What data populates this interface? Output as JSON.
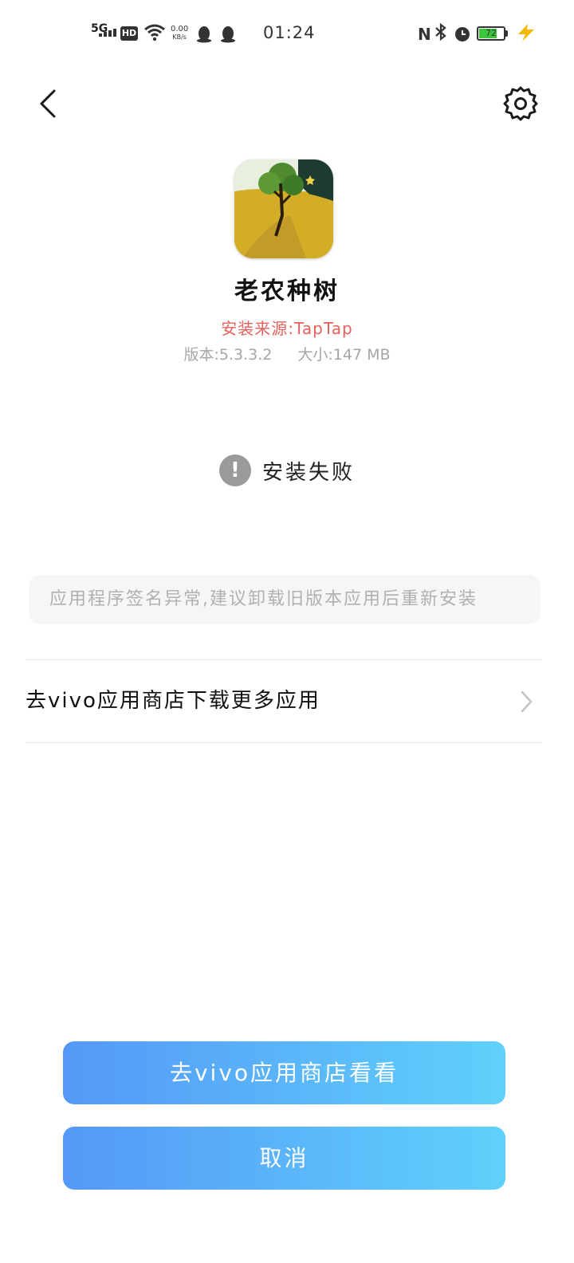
{
  "status_bar": {
    "network": "5G",
    "hd": "HD",
    "speed_value": "0.00",
    "speed_unit": "KB/s",
    "time": "01:24",
    "nfc": "N",
    "battery_level": "72",
    "battery_fraction": 0.72,
    "battery_color": "#3cc53c"
  },
  "header": {
    "back_icon": "chevron-left-icon",
    "settings_icon": "gear-icon"
  },
  "app": {
    "name": "老农种树",
    "install_source": "安装来源:TapTap",
    "version": "版本:5.3.3.2",
    "size": "大小:147 MB"
  },
  "install_status": {
    "icon": "exclamation-icon",
    "text": "安装失败"
  },
  "message": "应用程序签名异常,建议卸载旧版本应用后重新安装",
  "store_link": {
    "label": "去vivo应用商店下载更多应用"
  },
  "buttons": {
    "go_store": "去vivo应用商店看看",
    "cancel": "取消"
  },
  "colors": {
    "accent_start": "#5598f7",
    "accent_end": "#5fd1fb",
    "source_text": "#e8605c",
    "secondary_text": "#a6a6a6"
  }
}
